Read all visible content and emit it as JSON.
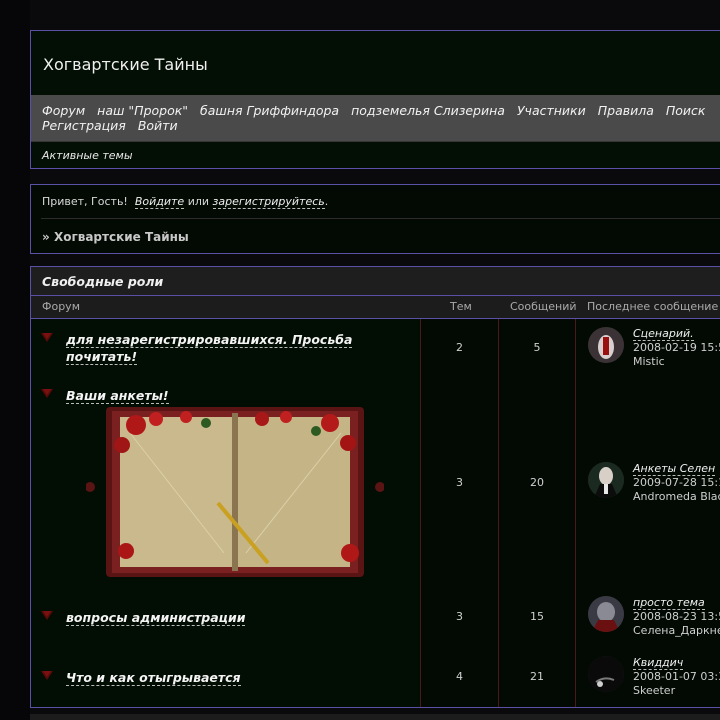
{
  "board": {
    "title": "Хогвартские Тайны"
  },
  "nav": {
    "items": [
      "Форум",
      "наш \"Пророк\"",
      "башня Гриффиндора",
      "подземелья Слизерина",
      "Участники",
      "Правила",
      "Поиск",
      "Регистрация",
      "Войти"
    ],
    "active_topics": "Активные темы"
  },
  "welcome": {
    "greeting": "Привет, Гость!",
    "login_link": "Войдите",
    "or": "или",
    "register_link": "зарегистрируйтесь",
    "period": ".",
    "crumb_prefix": "»",
    "crumb": "Хогвартские Тайны"
  },
  "category": {
    "title": "Свободные роли",
    "columns": {
      "forum": "Форум",
      "topics": "Тем",
      "posts": "Сообщений",
      "last": "Последнее сообщение"
    },
    "forums": [
      {
        "name": "для незарегистрировавшихся. Просьба почитать!",
        "topics": "2",
        "posts": "5",
        "last_title": "Сценарий.",
        "last_date": "2008-02-19 15:5",
        "last_user": "Mistic"
      },
      {
        "name": "Ваши анкеты!",
        "topics": "3",
        "posts": "20",
        "last_title": "Анкеты Селен",
        "last_date": "2009-07-28 15:1",
        "last_user": "Andromeda Blac"
      },
      {
        "name": "вопросы администрации",
        "topics": "3",
        "posts": "15",
        "last_title": "просто тема",
        "last_date": "2008-08-23 13:5",
        "last_user": "Селена_Даркне"
      },
      {
        "name": "Что и как отыгрывается",
        "topics": "4",
        "posts": "21",
        "last_title": "Квиддич",
        "last_date": "2008-01-07 03:3",
        "last_user": "Skeeter"
      }
    ]
  },
  "colors": {
    "border": "#5a50a8",
    "nav_bg": "#4a4a4a",
    "row_bg": "#020d03",
    "page_bg": "#0a0a0c"
  }
}
